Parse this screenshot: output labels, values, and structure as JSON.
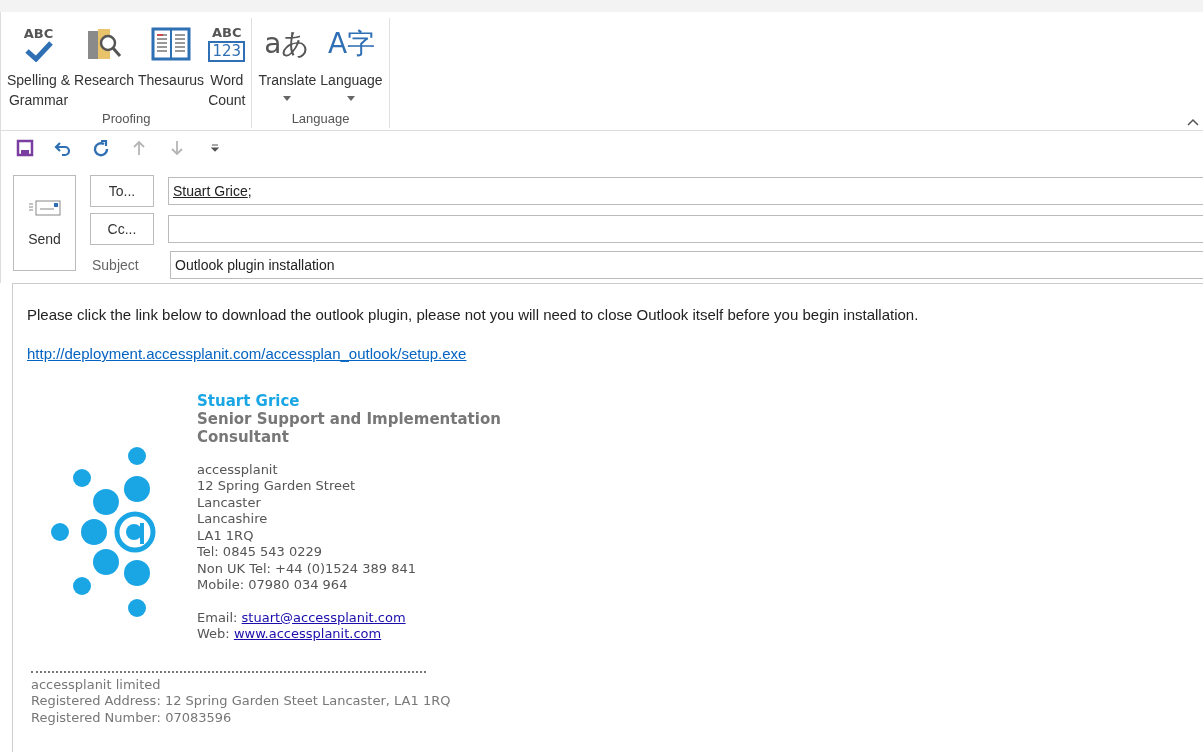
{
  "ribbon": {
    "groups": [
      {
        "label": "Proofing",
        "buttons": [
          {
            "kind": "spelling",
            "label": "Spelling &\nGrammar",
            "glyphs": [
              "ABC"
            ],
            "dropdown": false
          },
          {
            "kind": "research",
            "label": "Research",
            "dropdown": false
          },
          {
            "kind": "thesaurus",
            "label": "Thesaurus",
            "dropdown": false
          },
          {
            "kind": "wordcount",
            "label": "Word\nCount",
            "glyphs": [
              "ABC",
              "123"
            ],
            "dropdown": false
          }
        ]
      },
      {
        "label": "Language",
        "buttons": [
          {
            "kind": "translate",
            "label": "Translate",
            "glyphs": [
              "a",
              "あ"
            ],
            "dropdown": true
          },
          {
            "kind": "language",
            "label": "Language",
            "glyphs": [
              "A",
              "字"
            ],
            "dropdown": true
          }
        ]
      }
    ]
  },
  "quick_access": [
    {
      "kind": "save",
      "disabled": false
    },
    {
      "kind": "undo",
      "disabled": false
    },
    {
      "kind": "redo",
      "disabled": false
    },
    {
      "kind": "up",
      "disabled": true
    },
    {
      "kind": "down",
      "disabled": true
    },
    {
      "kind": "customize",
      "disabled": false
    }
  ],
  "header": {
    "send": "Send",
    "to_button": "To...",
    "to_value": "Stuart Grice",
    "to_sep": ";",
    "cc_button": "Cc...",
    "subject_label": "Subject",
    "subject_value": "Outlook plugin installation"
  },
  "body": {
    "message": "Please click the link below to download the outlook plugin, please not you will need to close Outlook itself before you begin installation.",
    "link": "http://deployment.accessplanit.com/accessplan_outlook/setup.exe",
    "signature": {
      "name": "Stuart Grice",
      "title": "Senior Support and Implementation\nConsultant",
      "lines": [
        "accessplanit",
        "12 Spring Garden  Street",
        "Lancaster",
        "Lancashire",
        "LA1 1RQ",
        "Tel: 0845 543 0229",
        "Non UK Tel: +44 (0)1524 389 841",
        "Mobile: 07980 034 964"
      ],
      "email_label": "Email:",
      "email": "stuart@accessplanit.com",
      "web_label": "Web:",
      "web": "www.accessplanit.com"
    },
    "footer": [
      "accessplanit limited",
      "Registered Address: 12 Spring Garden Steet Lancaster, LA1 1RQ",
      "Registered Number: 07083596"
    ]
  }
}
